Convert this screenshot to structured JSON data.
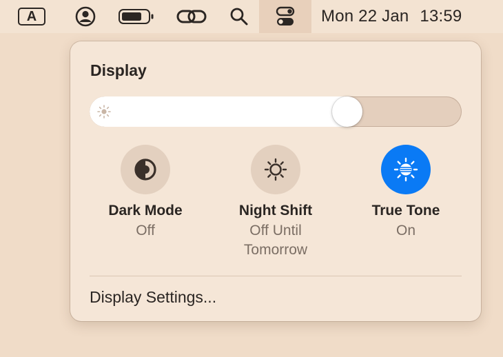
{
  "menubar": {
    "input_source": "A",
    "icons": [
      "input-source-icon",
      "user-icon",
      "battery-icon",
      "link-icon",
      "search-icon",
      "control-center-icon"
    ],
    "clock": {
      "date": "Mon 22 Jan",
      "time": "13:59"
    }
  },
  "display_panel": {
    "title": "Display",
    "brightness": {
      "fraction": 0.71
    },
    "toggles": [
      {
        "label": "Dark Mode",
        "status": "Off",
        "on": false,
        "icon": "dark-mode-icon"
      },
      {
        "label": "Night Shift",
        "status": "Off Until Tomorrow",
        "on": false,
        "icon": "night-shift-icon"
      },
      {
        "label": "True Tone",
        "status": "On",
        "on": true,
        "icon": "true-tone-icon"
      }
    ],
    "settings_link": "Display Settings..."
  },
  "colors": {
    "background": "#f0dcc8",
    "accent": "#0a7af5",
    "panel": "#f5e6d7"
  }
}
